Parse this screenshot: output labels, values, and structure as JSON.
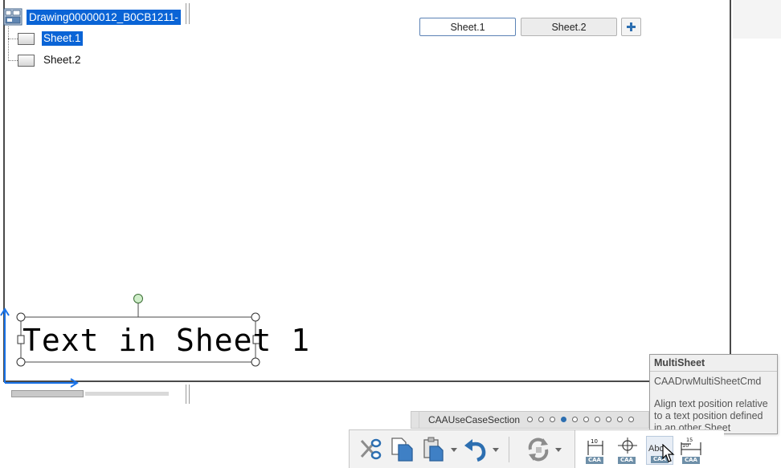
{
  "tree": {
    "root_label": "Drawing00000012_B0CB1211-",
    "items": [
      {
        "label": "Sheet.1",
        "selected": true
      },
      {
        "label": "Sheet.2",
        "selected": false
      }
    ]
  },
  "tabs": [
    {
      "label": "Sheet.1",
      "active": true
    },
    {
      "label": "Sheet.2",
      "active": false
    }
  ],
  "add_tab_icon": "plus-icon",
  "drawing": {
    "text": "Text in Sheet 1"
  },
  "tooltip": {
    "title": "MultiSheet",
    "command": "CAADrwMultiSheetCmd",
    "description": "Align text position relative to a text position defined in an other Sheet"
  },
  "section_bar": {
    "label": "CAAUseCaseSection",
    "page_count": 10,
    "active_page": 4
  },
  "toolbar": {
    "icons": [
      "cut-icon",
      "copy-icon",
      "paste-icon",
      "undo-icon",
      "update-icon"
    ],
    "caa_label": "CAA",
    "abc_text": "Abc"
  },
  "colors": {
    "selection": "#0a64d6",
    "axis": "#1a73e8",
    "accent": "#2d6fb1"
  }
}
